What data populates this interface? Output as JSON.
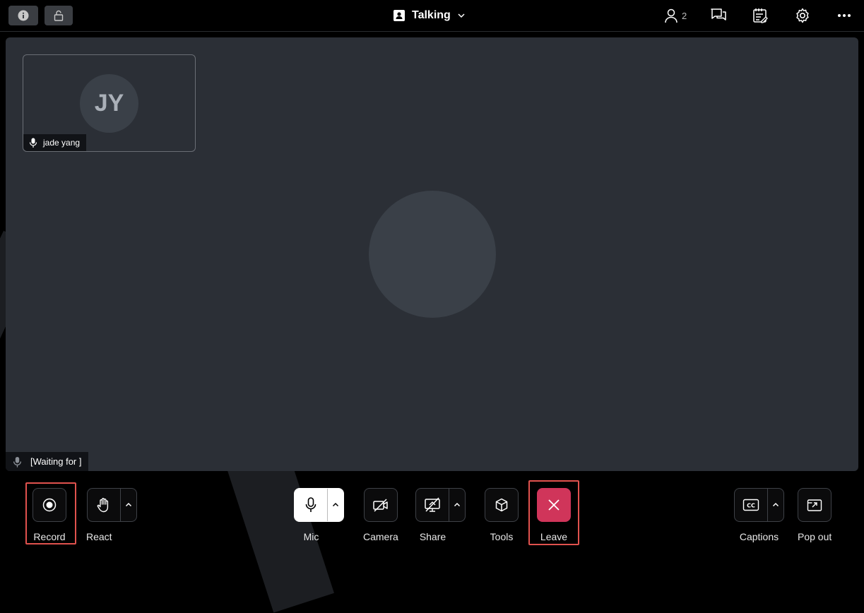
{
  "topbar": {
    "title": "Talking",
    "participant_count": "2",
    "icons": [
      "info-icon",
      "lock-icon",
      "contact-card-icon",
      "chevron-down-icon",
      "people-icon",
      "chat-icon",
      "notes-icon",
      "gear-icon",
      "more-icon"
    ]
  },
  "stage": {
    "tile": {
      "initials": "JY",
      "name": "jade yang"
    },
    "waiting_text": "[Waiting for ]"
  },
  "toolbar": {
    "record": "Record",
    "react": "React",
    "mic": "Mic",
    "camera": "Camera",
    "share": "Share",
    "tools": "Tools",
    "leave": "Leave",
    "captions": "Captions",
    "popout": "Pop out"
  },
  "colors": {
    "leave": "#d0355a",
    "highlight": "#e0524e",
    "stage": "#2b2f36"
  }
}
